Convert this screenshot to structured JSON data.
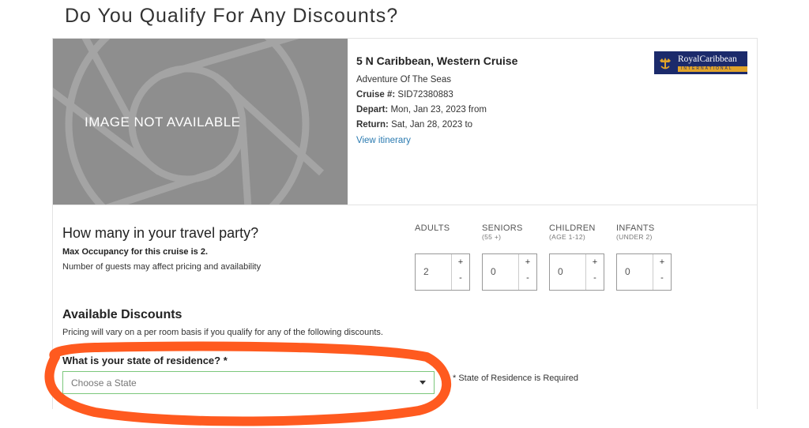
{
  "page": {
    "title": "Do You Qualify For Any Discounts?"
  },
  "image": {
    "label": "IMAGE NOT AVAILABLE"
  },
  "cruise": {
    "name": "5 N Caribbean, Western Cruise",
    "ship": "Adventure Of The Seas",
    "cruise_no_label": "Cruise #:",
    "cruise_no": "SID72380883",
    "depart_label": "Depart:",
    "depart": "Mon, Jan 23, 2023 from",
    "return_label": "Return:",
    "return": "Sat, Jan 28, 2023 to",
    "itinerary_link": "View itinerary"
  },
  "logo": {
    "main": "RoyalCaribbean",
    "sub": "INTERNATIONAL",
    "colors": {
      "navy": "#1b2a6b",
      "gold": "#e0a32a"
    }
  },
  "party": {
    "title": "How many in your travel party?",
    "max_occupancy": "Max Occupancy for this cruise is 2.",
    "note": "Number of guests may affect pricing and availability",
    "guests": [
      {
        "label": "ADULTS",
        "sub": "",
        "value": "2"
      },
      {
        "label": "SENIORS",
        "sub": "(55 +)",
        "value": "0"
      },
      {
        "label": "CHILDREN",
        "sub": "(AGE 1-12)",
        "value": "0"
      },
      {
        "label": "INFANTS",
        "sub": "(UNDER 2)",
        "value": "0"
      }
    ],
    "plus": "+",
    "minus": "-"
  },
  "discounts": {
    "title": "Available Discounts",
    "note": "Pricing will vary on a per room basis if you qualify for any of the following discounts.",
    "state_label": "What is your state of residence? *",
    "state_placeholder": "Choose a State",
    "state_error": "* State of Residence is Required"
  },
  "colors": {
    "link": "#2a7ab0",
    "select_border": "#7cc77c",
    "annotation": "#ff5a1f",
    "image_bg": "#8e8e8e"
  }
}
